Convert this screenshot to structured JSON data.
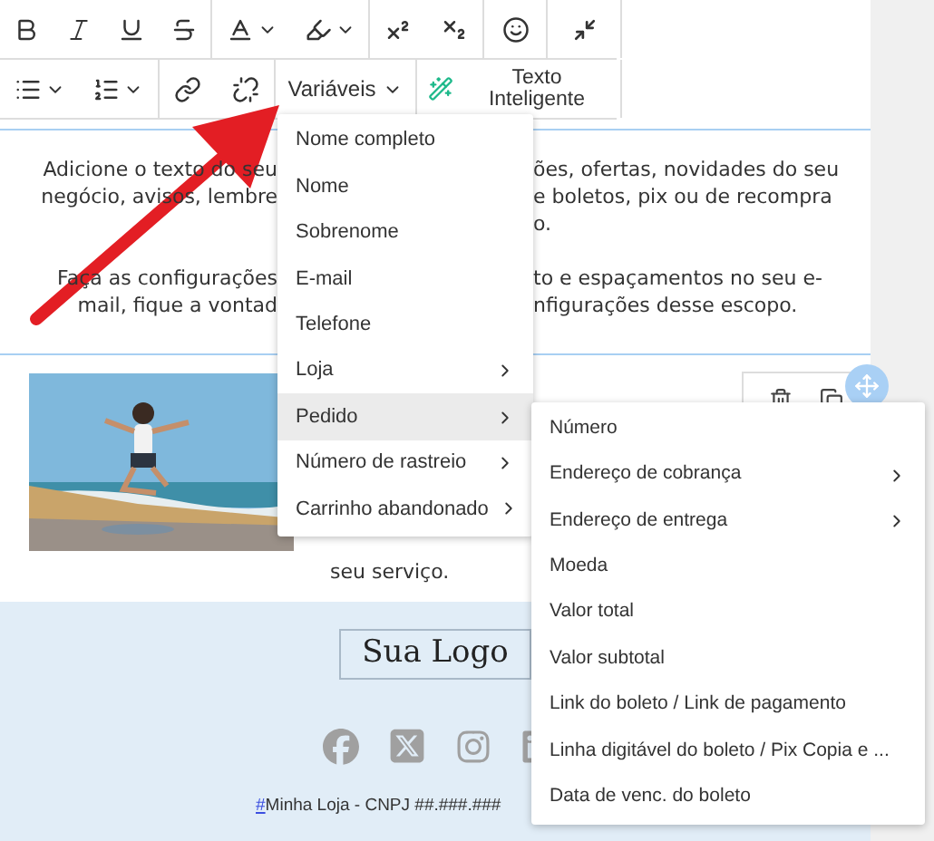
{
  "toolbar": {
    "variables_button": "Variáveis",
    "smart_text_button": "Texto Inteligente"
  },
  "text_block": {
    "paragraphs": [
      {
        "lines": [
          {
            "left": "Adicione o texto do seu",
            "right": "ões, ofertas, novidades do seu"
          },
          {
            "left": "negócio, avisos, lembre",
            "right": "e boletos, pix ou de recompra"
          },
          {
            "right": "o."
          }
        ]
      },
      {
        "lines": [
          {
            "left": "Faça as configurações",
            "right": "to e espaçamentos no seu e-"
          },
          {
            "left": "mail, fique a vontad",
            "right": "nfigurações desse escopo."
          }
        ]
      }
    ]
  },
  "image_block": {
    "caption": "seu serviço."
  },
  "variables_menu": {
    "items": [
      {
        "label": "Nome completo",
        "has_submenu": false,
        "selected": false
      },
      {
        "label": "Nome",
        "has_submenu": false,
        "selected": false
      },
      {
        "label": "Sobrenome",
        "has_submenu": false,
        "selected": false
      },
      {
        "label": "E-mail",
        "has_submenu": false,
        "selected": false
      },
      {
        "label": "Telefone",
        "has_submenu": false,
        "selected": false
      },
      {
        "label": "Loja",
        "has_submenu": true,
        "selected": false
      },
      {
        "label": "Pedido",
        "has_submenu": true,
        "selected": true
      },
      {
        "label": "Número de rastreio",
        "has_submenu": true,
        "selected": false
      },
      {
        "label": "Carrinho abandonado",
        "has_submenu": true,
        "selected": false
      }
    ]
  },
  "submenu": {
    "items": [
      {
        "label": "Número",
        "has_submenu": false
      },
      {
        "label": "Endereço de cobrança",
        "has_submenu": true
      },
      {
        "label": "Endereço de entrega",
        "has_submenu": true
      },
      {
        "label": "Moeda",
        "has_submenu": false
      },
      {
        "label": "Valor total",
        "has_submenu": false
      },
      {
        "label": "Valor subtotal",
        "has_submenu": false
      },
      {
        "label": "Link do boleto / Link de pagamento",
        "has_submenu": false
      },
      {
        "label": "Linha digitável do boleto / Pix Copia e ...",
        "has_submenu": false
      },
      {
        "label": "Data de venc. do boleto",
        "has_submenu": false
      }
    ]
  },
  "footer": {
    "logo": "Sua Logo",
    "link": "#",
    "text": "Minha Loja - CNPJ ##.###.###"
  }
}
